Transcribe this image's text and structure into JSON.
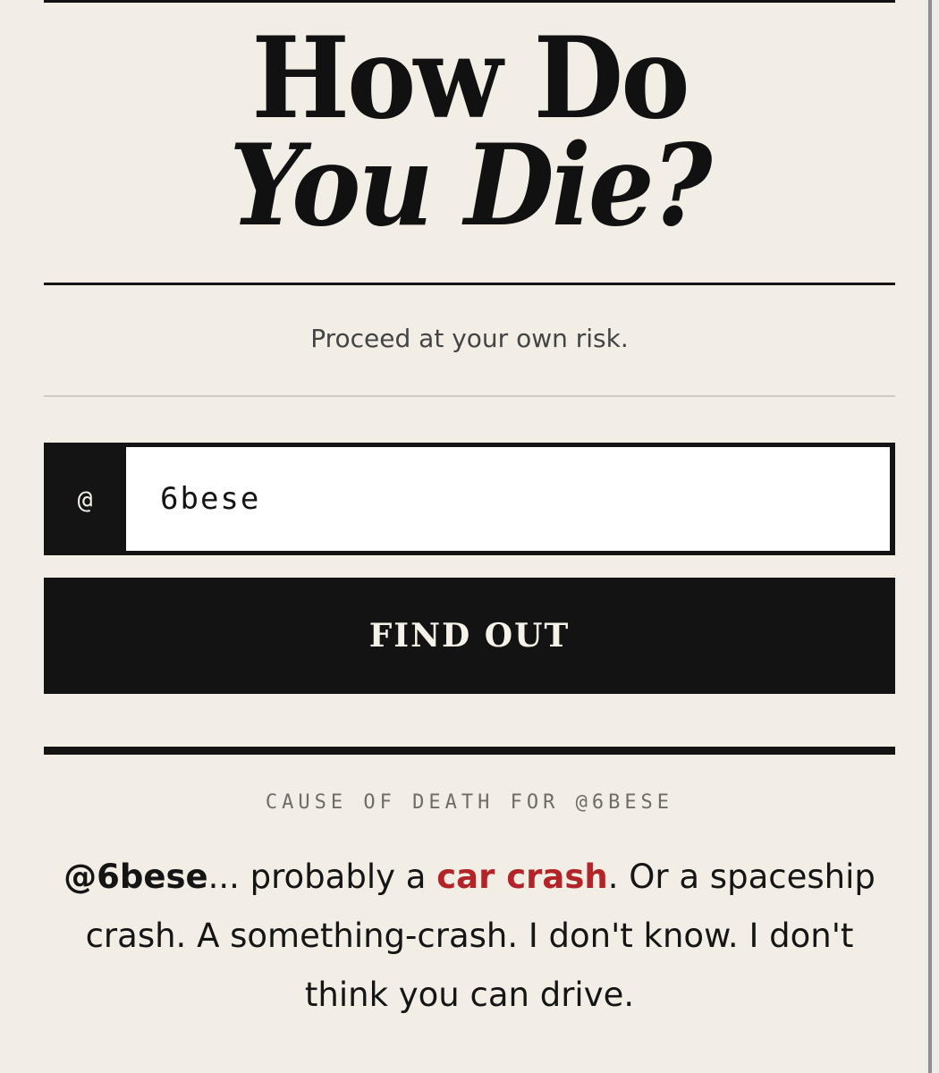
{
  "header": {
    "title_line1": "How Do",
    "title_line2": "You Die?"
  },
  "tagline": "Proceed at your own risk.",
  "form": {
    "prefix": "@",
    "username_value": "6bese",
    "button_label": "FIND OUT"
  },
  "result": {
    "label": "CAUSE OF DEATH FOR @6BESE",
    "handle": "@6bese",
    "text_before": "... probably a ",
    "cause": "car crash",
    "text_after": ". Or a spaceship crash. A something-crash. I don't know. I don't think you can drive."
  },
  "colors": {
    "background": "#f2eee6",
    "ink": "#141414",
    "accent": "#b32428"
  }
}
